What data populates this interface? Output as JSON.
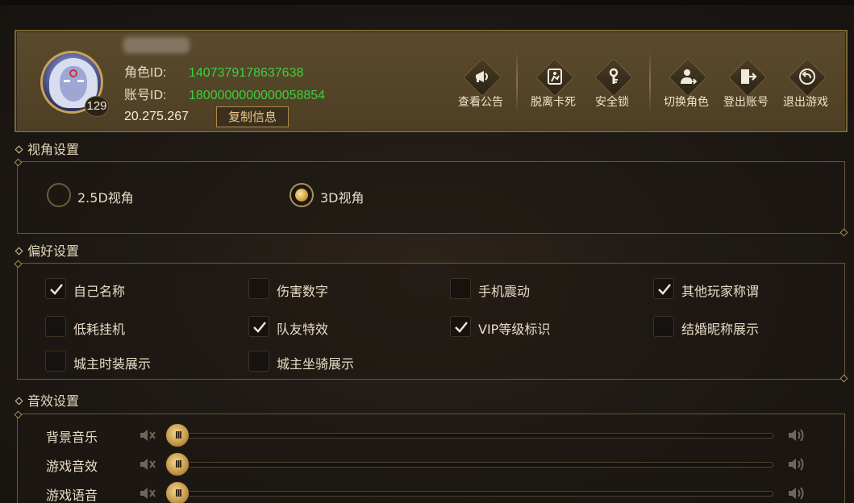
{
  "profile": {
    "name": "",
    "level": "129",
    "role_id_label": "角色ID:",
    "role_id": "1407379178637638",
    "account_id_label": "账号ID:",
    "account_id": "1800000000000058854",
    "currency": "20.275.267",
    "copy_button": "复制信息"
  },
  "actions": [
    {
      "label": "查看公告",
      "icon": "announcement-icon"
    },
    {
      "label": "脱离卡死",
      "icon": "unstuck-icon"
    },
    {
      "label": "安全锁",
      "icon": "key-icon"
    },
    {
      "label": "切换角色",
      "icon": "switch-character-icon"
    },
    {
      "label": "登出账号",
      "icon": "logout-icon"
    },
    {
      "label": "退出游戏",
      "icon": "exit-game-icon"
    }
  ],
  "view_section": {
    "title": "视角设置",
    "options": [
      {
        "label": "2.5D视角",
        "selected": false
      },
      {
        "label": "3D视角",
        "selected": true
      }
    ]
  },
  "pref_section": {
    "title": "偏好设置",
    "items": [
      {
        "label": "自己名称",
        "checked": true
      },
      {
        "label": "伤害数字",
        "checked": false
      },
      {
        "label": "手机震动",
        "checked": false
      },
      {
        "label": "其他玩家称谓",
        "checked": true
      },
      {
        "label": "低耗挂机",
        "checked": false
      },
      {
        "label": "队友特效",
        "checked": true
      },
      {
        "label": "VIP等级标识",
        "checked": true
      },
      {
        "label": "结婚昵称展示",
        "checked": false
      },
      {
        "label": "城主时装展示",
        "checked": false
      },
      {
        "label": "城主坐骑展示",
        "checked": false
      }
    ]
  },
  "sound_section": {
    "title": "音效设置",
    "sliders": [
      {
        "label": "背景音乐",
        "value": 0
      },
      {
        "label": "游戏音效",
        "value": 0
      },
      {
        "label": "游戏语音",
        "value": 0
      }
    ]
  },
  "colors": {
    "accent_gold": "#c9a25a",
    "id_green": "#3ecf3e",
    "panel_bg": "#4e3f25"
  }
}
